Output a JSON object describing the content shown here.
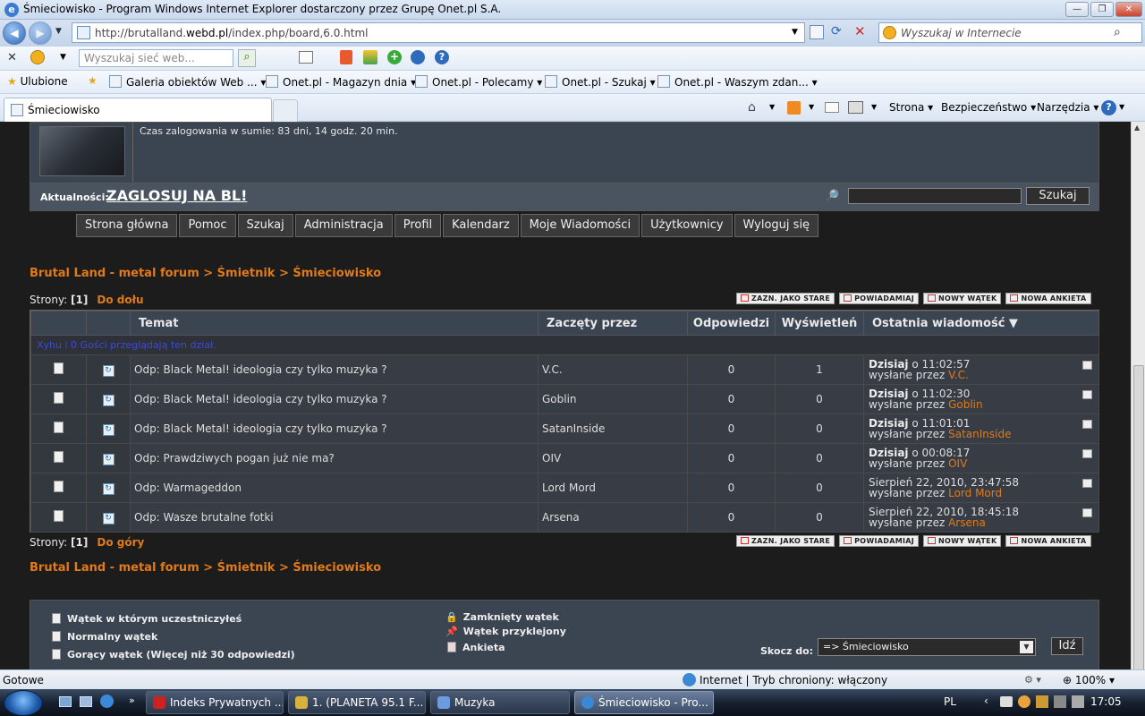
{
  "window": {
    "title": "Śmieciowisko - Program Windows Internet Explorer dostarczony przez Grupę Onet.pl S.A.",
    "min": "—",
    "max": "❐",
    "close": "✕"
  },
  "nav": {
    "back": "◀",
    "forward": "▶",
    "url_prefix": "http://brutalland.",
    "url_domain": "webd.pl",
    "url_suffix": "/index.php/board,6.0.html",
    "search_placeholder": "Wyszukaj w Internecie"
  },
  "toolbar1": {
    "search_web": "Wyszukaj sieć web..."
  },
  "favorites": {
    "label": "Ulubione",
    "items": [
      "Galeria obiektów Web ...",
      "Onet.pl - Magazyn dnia",
      "Onet.pl - Polecamy",
      "Onet.pl - Szukaj",
      "Onet.pl - Waszym zdan..."
    ]
  },
  "tabs": {
    "active": "Śmieciowisko"
  },
  "commands": {
    "page": "Strona",
    "security": "Bezpieczeństwo",
    "tools": "Narzędzia",
    "help": "?"
  },
  "forum": {
    "logged_time": "Czas zalogowania w sumie: 83 dni, 14 godz. 20 min.",
    "news_label": "Aktualności:",
    "news_value": "ZAGLOSUJ NA BL!",
    "search_button": "Szukaj",
    "menu": [
      "Strona główna",
      "Pomoc",
      "Szukaj",
      "Administracja",
      "Profil",
      "Kalendarz",
      "Moje Wiadomości",
      "Użytkownicy",
      "Wyloguj się"
    ],
    "breadcrumb": "Brutal Land - metal forum > Śmietnik > Śmieciowisko",
    "pages_label": "Strony:",
    "pages_value": "[1]",
    "down_link": "Do dołu",
    "up_link": "Do góry",
    "actions": [
      "ZAZN. JAKO STARE",
      "POWIADAMIAJ",
      "NOWY WĄTEK",
      "NOWA ANKIETA"
    ],
    "columns": {
      "topic": "Temat",
      "started": "Zaczęty przez",
      "replies": "Odpowiedzi",
      "views": "Wyświetleń",
      "last": "Ostatnia wiadomość ▼"
    },
    "viewers_user": "Xyhu",
    "viewers_rest": " i 0 Gości przeglądają ten dział.",
    "rows": [
      {
        "title": "Odp: Black Metal! ideologia czy tylko muzyka ?",
        "by": "V.C.",
        "replies": "0",
        "views": "1",
        "date_b": "Dzisiaj",
        "date": " o 11:02:57",
        "sent": "wysłane przez ",
        "user": "V.C."
      },
      {
        "title": "Odp: Black Metal! ideologia czy tylko muzyka ?",
        "by": "Goblin",
        "replies": "0",
        "views": "0",
        "date_b": "Dzisiaj",
        "date": " o 11:02:30",
        "sent": "wysłane przez ",
        "user": "Goblin"
      },
      {
        "title": "Odp: Black Metal! ideologia czy tylko muzyka ?",
        "by": "SatanInside",
        "replies": "0",
        "views": "0",
        "date_b": "Dzisiaj",
        "date": " o 11:01:01",
        "sent": "wysłane przez ",
        "user": "SatanInside"
      },
      {
        "title": "Odp: Prawdziwych pogan już nie ma?",
        "by": "OIV",
        "replies": "0",
        "views": "0",
        "date_b": "Dzisiaj",
        "date": " o 00:08:17",
        "sent": "wysłane przez ",
        "user": "OIV"
      },
      {
        "title": "Odp: Warmageddon",
        "by": "Lord Mord",
        "replies": "0",
        "views": "0",
        "date_b": "",
        "date": "Sierpień 22, 2010, 23:47:58",
        "sent": "wysłane przez ",
        "user": "Lord Mord"
      },
      {
        "title": "Odp: Wasze brutalne fotki",
        "by": "Arsena",
        "replies": "0",
        "views": "0",
        "date_b": "",
        "date": "Sierpień 22, 2010, 18:45:18",
        "sent": "wysłane przez ",
        "user": "Arsena"
      }
    ],
    "legend": {
      "participated": "Wątek w którym uczestniczyłeś",
      "normal": "Normalny wątek",
      "hot": "Gorący wątek (Więcej niż 30 odpowiedzi)",
      "locked": "Zamknięty wątek",
      "sticky": "Wątek przyklejony",
      "poll": "Ankieta"
    },
    "jump_label": "Skocz do:",
    "jump_value": "=> Śmieciowisko",
    "jump_button": "Idź"
  },
  "status": {
    "left": "Gotowe",
    "zone": "Internet | Tryb chroniony: włączony",
    "zoom": "100%"
  },
  "taskbar": {
    "tasks": [
      "Indeks Prywatnych ...",
      "1. (PLANETA 95.1 F...",
      "Muzyka",
      "Śmieciowisko - Pro..."
    ],
    "lang": "PL",
    "time": "17:05"
  }
}
